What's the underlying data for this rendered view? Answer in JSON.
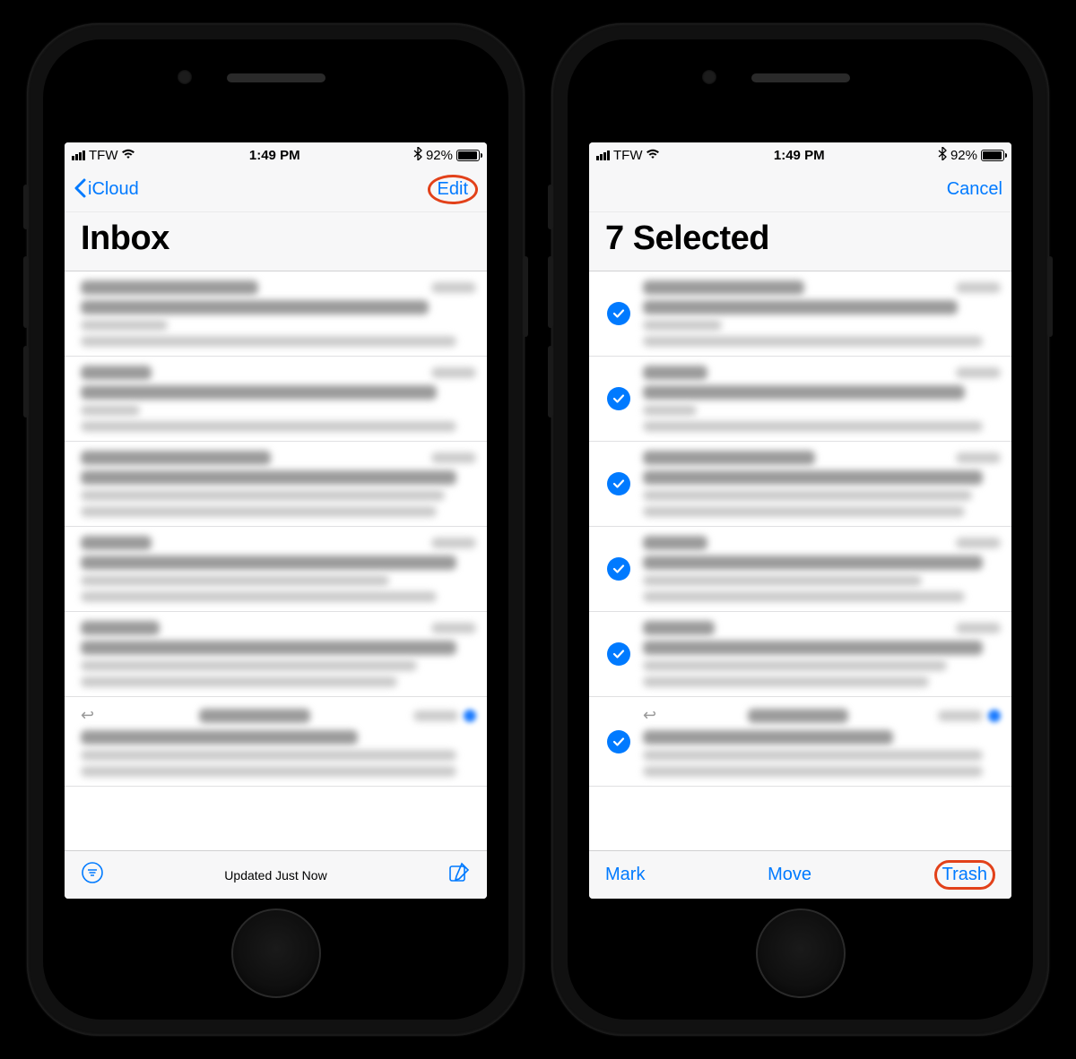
{
  "status": {
    "carrier": "TFW",
    "time": "1:49 PM",
    "battery_pct": "92%"
  },
  "left_phone": {
    "nav_back": "iCloud",
    "nav_right": "Edit",
    "title": "Inbox",
    "toolbar_status": "Updated Just Now"
  },
  "right_phone": {
    "nav_right": "Cancel",
    "title": "7 Selected",
    "toolbar": {
      "mark": "Mark",
      "move": "Move",
      "trash": "Trash"
    }
  },
  "messages": [
    {
      "sender_w": 45,
      "time_w": 18,
      "subject_w": 88,
      "lines": [
        22,
        95
      ]
    },
    {
      "sender_w": 18,
      "time_w": 18,
      "subject_w": 90,
      "lines": [
        15,
        95
      ]
    },
    {
      "sender_w": 48,
      "time_w": 20,
      "subject_w": 95,
      "lines": [
        92,
        90
      ]
    },
    {
      "sender_w": 18,
      "time_w": 14,
      "subject_w": 95,
      "lines": [
        78,
        90
      ]
    },
    {
      "sender_w": 20,
      "time_w": 18,
      "subject_w": 95,
      "lines": [
        85,
        80
      ]
    },
    {
      "sender_w": 28,
      "time_w": 18,
      "subject_w": 70,
      "lines": [
        95,
        95
      ],
      "reply": true,
      "badge": true
    }
  ]
}
